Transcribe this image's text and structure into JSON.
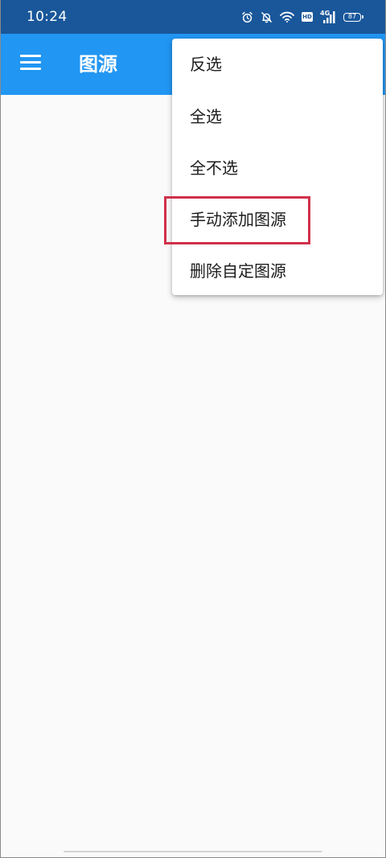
{
  "status_bar": {
    "time": "10:24",
    "hd_label": "HD",
    "network_label": "4G",
    "battery_level": "87",
    "icons": [
      "alarm-icon",
      "mute-icon",
      "wifi-icon",
      "hd-icon",
      "signal-4g-icon",
      "battery-icon"
    ],
    "background": "#19579a"
  },
  "app_bar": {
    "title": "图源",
    "background": "#2196f3",
    "menu_icon": "hamburger-icon"
  },
  "popup_menu": {
    "items": [
      {
        "label": "反选"
      },
      {
        "label": "全选"
      },
      {
        "label": "全不选"
      },
      {
        "label": "手动添加图源"
      },
      {
        "label": "删除自定图源"
      }
    ],
    "highlighted_index": 3,
    "highlight_color": "#d0304a"
  }
}
